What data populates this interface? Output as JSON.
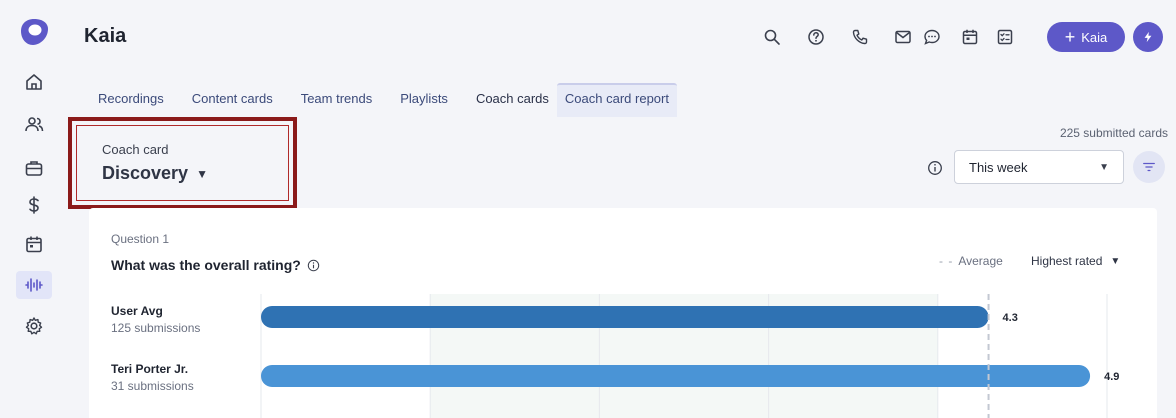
{
  "app": {
    "title": "Kaia"
  },
  "sidebar": {
    "items": [
      {
        "icon": "home-icon"
      },
      {
        "icon": "people-icon"
      },
      {
        "icon": "briefcase-icon"
      },
      {
        "icon": "dollar-icon"
      },
      {
        "icon": "calendar-icon"
      },
      {
        "icon": "waveform-icon",
        "active": true
      },
      {
        "icon": "gear-icon"
      }
    ]
  },
  "topbar": {
    "icons": [
      "search-icon",
      "help-icon",
      "phone-icon",
      "mail-icon",
      "chat-icon",
      "calendar-icon",
      "tasks-icon"
    ],
    "kaia_button": "Kaia",
    "kaia_plus": "+",
    "bolt_icon": "bolt-icon",
    "accent": "#5d58c8"
  },
  "tabs": [
    {
      "label": "Recordings"
    },
    {
      "label": "Content cards"
    },
    {
      "label": "Team trends"
    },
    {
      "label": "Playlists"
    },
    {
      "label": "Coach cards"
    },
    {
      "label": "Coach card report",
      "active": true
    }
  ],
  "coach_card": {
    "label": "Coach card",
    "value": "Discovery",
    "caret": "▼"
  },
  "submitted": "225 submitted cards",
  "period": {
    "value": "This week",
    "caret": "▼"
  },
  "question": {
    "number": "Question 1",
    "title": "What was the overall rating?",
    "legend_average": "Average",
    "sort": "Highest rated",
    "sort_caret": "▼"
  },
  "chart_data": {
    "type": "bar",
    "orientation": "horizontal",
    "categories": [
      "User Avg",
      "Teri Porter Jr."
    ],
    "subtitles": [
      "125 submissions",
      "31 submissions"
    ],
    "values": [
      4.3,
      4.9
    ],
    "value_labels": [
      "4.3",
      "4.9"
    ],
    "xlim": [
      0,
      5
    ],
    "average": 4.3,
    "colors": [
      "#2f72b3",
      "#4a94d6"
    ],
    "grid": true
  }
}
